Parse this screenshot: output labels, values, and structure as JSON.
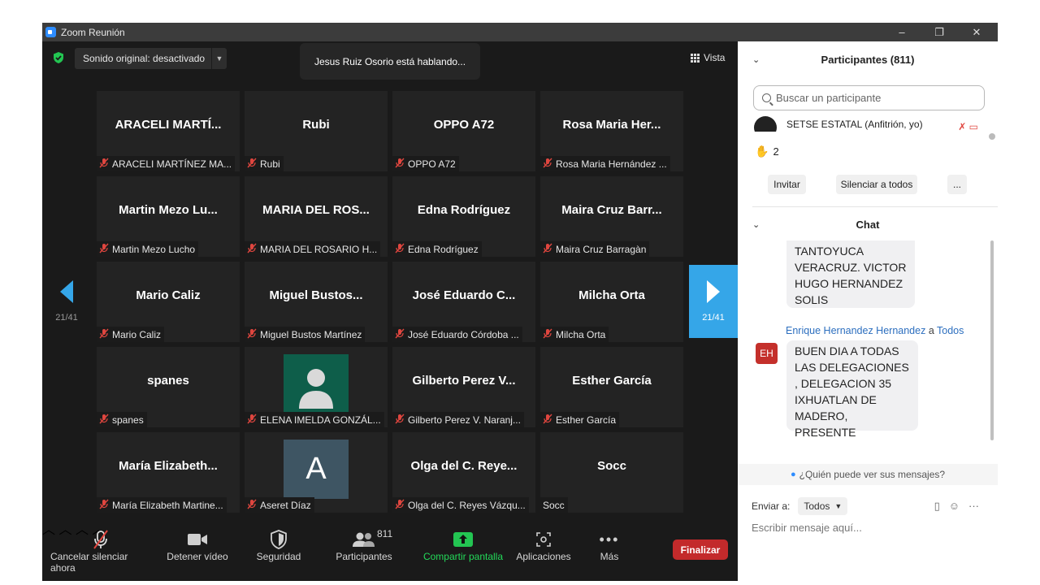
{
  "window": {
    "title": "Zoom Reunión",
    "min": "–",
    "max": "❐",
    "close": "✕"
  },
  "topbar": {
    "sound_label": "Sonido original: desactivado",
    "speaking": "Jesus Ruiz Osorio está hablando...",
    "view_label": "Vista"
  },
  "pager": {
    "prev_page": "21/41",
    "next_page": "21/41"
  },
  "tiles": [
    {
      "big": "ARACELI MARTÍ...",
      "cap": "ARACELI MARTÍNEZ MA..."
    },
    {
      "big": "Rubi",
      "cap": "Rubi"
    },
    {
      "big": "OPPO A72",
      "cap": "OPPO A72"
    },
    {
      "big": "Rosa Maria Her...",
      "cap": "Rosa Maria Hernández ..."
    },
    {
      "big": "Martin Mezo Lu...",
      "cap": "Martin Mezo Lucho"
    },
    {
      "big": "MARIA DEL ROS...",
      "cap": "MARIA DEL ROSARIO H..."
    },
    {
      "big": "Edna Rodríguez",
      "cap": "Edna Rodríguez"
    },
    {
      "big": "Maira Cruz Barr...",
      "cap": "Maira Cruz Barragàn"
    },
    {
      "big": "Mario Caliz",
      "cap": "Mario Caliz"
    },
    {
      "big": "Miguel Bustos...",
      "cap": "Miguel Bustos Martínez"
    },
    {
      "big": "José Eduardo C...",
      "cap": "José Eduardo Córdoba ..."
    },
    {
      "big": "Milcha Orta",
      "cap": "Milcha Orta"
    },
    {
      "big": "spanes",
      "cap": "spanes"
    },
    {
      "big": "",
      "cap": "ELENA IMELDA GONZÁL...",
      "avatar": "person"
    },
    {
      "big": "Gilberto Perez V...",
      "cap": "Gilberto Perez V. Naranj..."
    },
    {
      "big": "Esther García",
      "cap": "Esther García"
    },
    {
      "big": "María Elizabeth...",
      "cap": "María Elizabeth Martine..."
    },
    {
      "big": "",
      "cap": "Aseret Díaz",
      "avatar": "letter",
      "letter": "A"
    },
    {
      "big": "Olga del C. Reye...",
      "cap": "Olga del C. Reyes Vázqu..."
    },
    {
      "big": "Socc",
      "cap": "Socc",
      "no_mic": true
    }
  ],
  "toolbar": {
    "mute": "Cancelar silenciar ahora",
    "video": "Detener vídeo",
    "security": "Seguridad",
    "participants": "Participantes",
    "participants_count": "811",
    "share": "Compartir pantalla",
    "apps": "Aplicaciones",
    "more": "Más",
    "end": "Finalizar"
  },
  "participants_panel": {
    "title": "Participantes (811)",
    "search_placeholder": "Buscar un participante",
    "host_row": "SETSE ESTATAL (Anfitrión, yo)",
    "raised_count": "2",
    "invite": "Invitar",
    "mute_all": "Silenciar a todos",
    "more": "..."
  },
  "chat": {
    "title": "Chat",
    "msg1": "TANTOYUCA VERACRUZ. VICTOR HUGO HERNANDEZ SOLIS",
    "sender": "Enrique Hernandez Hernandez",
    "to_word": "a",
    "to": "Todos",
    "sender_initials": "EH",
    "msg2": "BUEN DIA A TODAS LAS DELEGACIONES , DELEGACION 35 IXHUATLAN DE MADERO, PRESENTE",
    "who_can_see": "¿Quién puede ver sus mensajes?",
    "send_to_label": "Enviar a:",
    "send_to_value": "Todos",
    "input_placeholder": "Escribir mensaje aquí..."
  },
  "colors": {
    "accent": "#35a6e8",
    "end": "#c32a2b",
    "share": "#23d959",
    "muted_mic": "#e0463f"
  }
}
